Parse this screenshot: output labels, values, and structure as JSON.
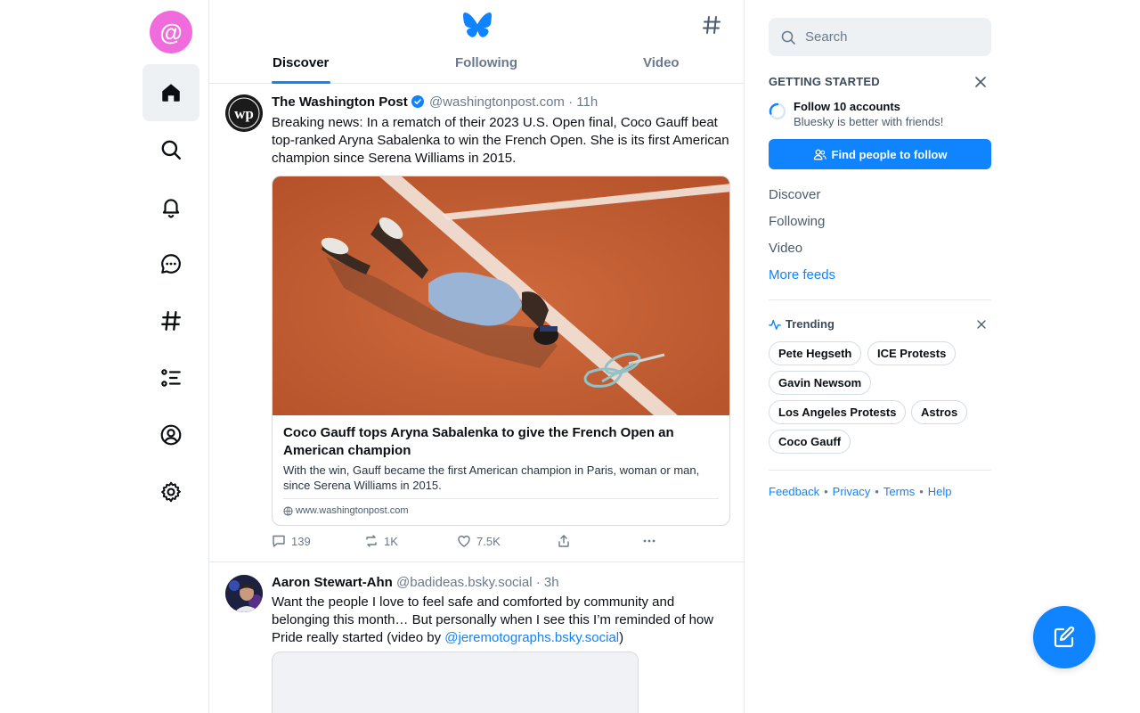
{
  "nav": {
    "items": [
      {
        "icon": "home-icon"
      },
      {
        "icon": "search-icon"
      },
      {
        "icon": "bell-icon"
      },
      {
        "icon": "chat-icon"
      },
      {
        "icon": "hashtag-icon"
      },
      {
        "icon": "lists-icon"
      },
      {
        "icon": "profile-icon"
      },
      {
        "icon": "settings-icon"
      }
    ],
    "active": "home",
    "avatar_glyph": "@"
  },
  "header": {
    "tabs": [
      {
        "label": "Discover"
      },
      {
        "label": "Following"
      },
      {
        "label": "Video"
      }
    ],
    "active_tab": "Discover"
  },
  "posts": [
    {
      "author": "The Washington Post",
      "handle": "@washingtonpost.com",
      "time": "· 11h",
      "text": "Breaking news: In a rematch of their 2023 U.S. Open final, Coco Gauff beat top-ranked Aryna Sabalenka to win the French Open. She is its first American champion since Serena Williams in 2015.",
      "card": {
        "title": "Coco Gauff tops Aryna Sabalenka to give the French Open an American champion",
        "description": "With the win, Gauff became the first American champion in Paris, woman or man, since Serena Williams in 2015.",
        "domain": "www.washingtonpost.com"
      },
      "stats": {
        "replies": "139",
        "reposts": "1K",
        "likes": "7.5K"
      }
    },
    {
      "author": "Aaron Stewart-Ahn",
      "handle": "@badideas.bsky.social",
      "time": "· 3h",
      "text_before": "Want the people I love to feel safe and comforted by community and belonging this month… But personally when I see this I’m reminded of how Pride really started (video by ",
      "mention": "@jeremotographs.bsky.social",
      "text_after": ")"
    }
  ],
  "sidebar": {
    "search_placeholder": "Search",
    "getting_started": {
      "label": "GETTING STARTED",
      "title": "Follow 10 accounts",
      "subtitle": "Bluesky is better with friends!",
      "button": "Find people to follow"
    },
    "feeds": [
      "Discover",
      "Following",
      "Video"
    ],
    "more_feeds": "More feeds",
    "trending": {
      "label": "Trending",
      "topics": [
        "Pete Hegseth",
        "ICE Protests",
        "Gavin Newsom",
        "Los Angeles Protests",
        "Astros",
        "Coco Gauff"
      ]
    },
    "footer": [
      "Feedback",
      "Privacy",
      "Terms",
      "Help"
    ]
  },
  "colors": {
    "accent": "#1083fe",
    "avatar_pink": "#f06bdc"
  }
}
